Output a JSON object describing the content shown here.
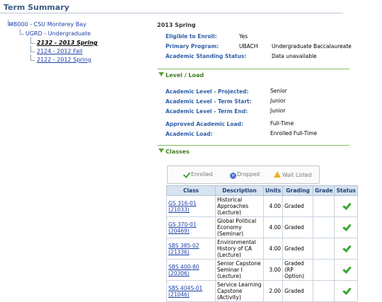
{
  "header": {
    "title": "Term Summary"
  },
  "tree": {
    "campus": "MB000 - CSU Monterey Bay",
    "career": "UGRD - Undergraduate",
    "terms": [
      {
        "label": "2132 - 2013 Spring",
        "current": true
      },
      {
        "label": "2124 - 2012 Fall",
        "current": false
      },
      {
        "label": "2122 - 2012 Spring",
        "current": false
      }
    ]
  },
  "summary": {
    "term_title": "2013 Spring",
    "eligible_label": "Eligible to Enroll:",
    "eligible_value": "Yes",
    "program_label": "Primary Program:",
    "program_code": "UBACH",
    "program_value": "Undergraduate Baccalaureate",
    "standing_label": "Academic Standing Status:",
    "standing_value": "Data unavailable"
  },
  "level_load": {
    "title": "Level / Load",
    "projected_label": "Academic Level - Projected:",
    "projected_value": "Senior",
    "term_start_label": "Academic Level - Term Start:",
    "term_start_value": "Junior",
    "term_end_label": "Academic Level - Term End:",
    "term_end_value": "Junior",
    "approved_load_label": "Approved Academic Load:",
    "approved_load_value": "Full-Time",
    "load_label": "Academic Load:",
    "load_value": "Enrolled Full-Time"
  },
  "classes": {
    "title": "Classes",
    "legend": {
      "enrolled": "Enrolled",
      "dropped": "Dropped",
      "waitlisted": "Wait Listed"
    },
    "columns": [
      "Class",
      "Description",
      "Units",
      "Grading",
      "Grade",
      "Status"
    ],
    "rows": [
      {
        "class_line1": "GS 316-01",
        "class_line2": "(21033)",
        "description": "Historical Approaches (Lecture)",
        "units": "4.00",
        "grading": "Graded",
        "grade": ""
      },
      {
        "class_line1": "GS 370-01",
        "class_line2": "(20469)",
        "description": "Global Political Economy (Seminar)",
        "units": "4.00",
        "grading": "Graded",
        "grade": ""
      },
      {
        "class_line1": "SBS 385-02",
        "class_line2": "(21336)",
        "description": "Environmental History of CA (Lecture)",
        "units": "4.00",
        "grading": "Graded",
        "grade": ""
      },
      {
        "class_line1": "SBS 400-80",
        "class_line2": "(20306)",
        "description": "Senior Capstone Seminar I (Lecture)",
        "units": "3.00",
        "grading": "Graded (RP Option)",
        "grade": ""
      },
      {
        "class_line1": "SBS 404S-01",
        "class_line2": "(21046)",
        "description": "Service Learning Capstone (Activity)",
        "units": "2.00",
        "grading": "Graded",
        "grade": ""
      }
    ]
  }
}
